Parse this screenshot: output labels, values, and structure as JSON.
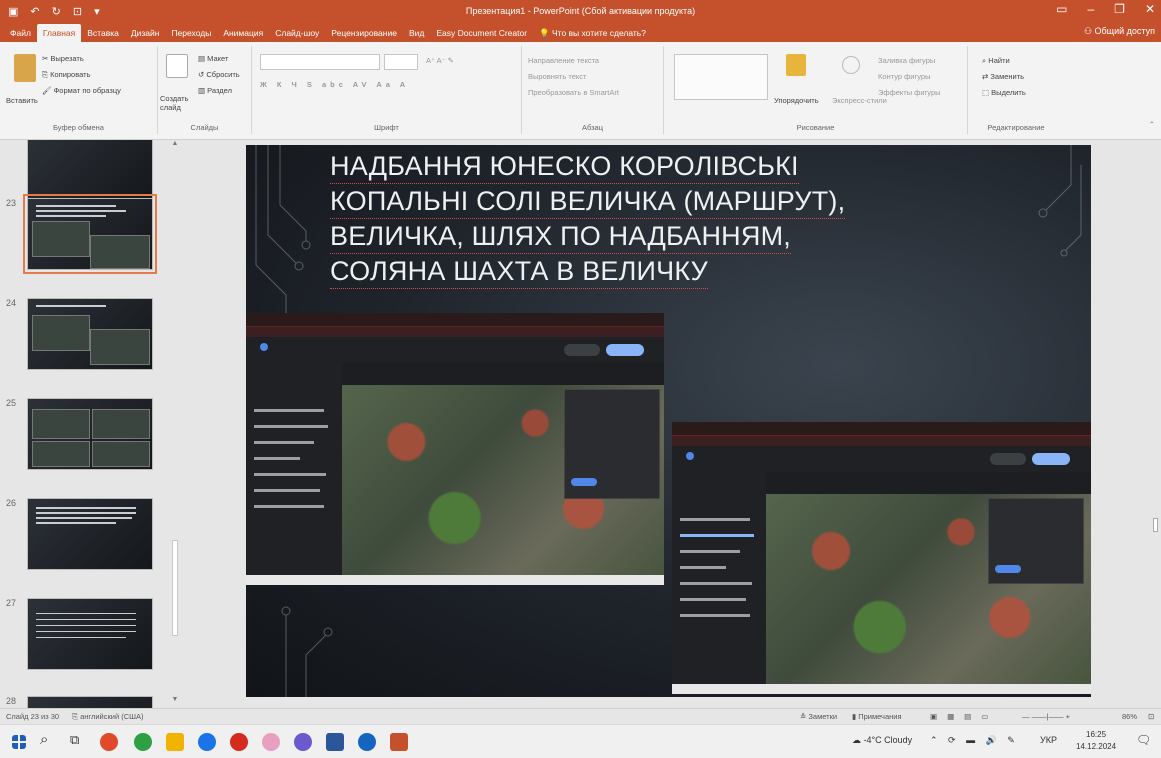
{
  "window": {
    "title": "Презентация1 - PowerPoint (Сбой активации продукта)"
  },
  "tabs": [
    "Файл",
    "Главная",
    "Вставка",
    "Дизайн",
    "Переходы",
    "Анимация",
    "Слайд-шоу",
    "Рецензирование",
    "Вид",
    "Easy Document Creator",
    "Что вы хотите сделать?"
  ],
  "active_tab_index": 1,
  "share_label": "Общий доступ",
  "ribbon": {
    "clipboard": {
      "paste": "Вставить",
      "cut": "Вырезать",
      "copy": "Копировать",
      "format_painter": "Формат по образцу",
      "label": "Буфер обмена"
    },
    "slides": {
      "new_slide": "Создать слайд",
      "layout": "Макет",
      "reset": "Сбросить",
      "section": "Раздел",
      "label": "Слайды"
    },
    "font": {
      "label": "Шрифт"
    },
    "paragraph": {
      "text_direction": "Направление текста",
      "align_text": "Выровнять текст",
      "smartart": "Преобразовать в SmartArt",
      "label": "Абзац"
    },
    "drawing": {
      "arrange": "Упорядочить",
      "quick_styles": "Экспресс-стили",
      "shape_fill": "Заливка фигуры",
      "shape_outline": "Контур фигуры",
      "shape_effects": "Эффекты фигуры",
      "label": "Рисование"
    },
    "editing": {
      "find": "Найти",
      "replace": "Заменить",
      "select": "Выделить",
      "label": "Редактирование"
    }
  },
  "thumbnails": [
    {
      "num": "",
      "selected": false
    },
    {
      "num": "23",
      "selected": true
    },
    {
      "num": "24",
      "selected": false
    },
    {
      "num": "25",
      "selected": false
    },
    {
      "num": "26",
      "selected": false
    },
    {
      "num": "27",
      "selected": false
    },
    {
      "num": "28",
      "selected": false
    }
  ],
  "slide": {
    "title_lines": [
      "НАДБАННЯ ЮНЕСКО КОРОЛІВСЬКІ",
      "КОПАЛЬНІ СОЛІ ВЕЛИЧКА (МАРШРУТ),",
      "ВЕЛИЧКА, ШЛЯХ ПО НАДБАННЯМ,",
      "СОЛЯНА ШАХТА В ВЕЛИЧКУ"
    ]
  },
  "statusbar": {
    "slide_info": "Слайд 23 из 30",
    "language": "английский (США)",
    "notes": "Заметки",
    "comments": "Примечания",
    "zoom": "86%"
  },
  "taskbar": {
    "weather": "-4°C Cloudy",
    "lang": "УКР",
    "time": "16:25",
    "date": "14.12.2024"
  },
  "colors": {
    "accent": "#c5512c",
    "slide_bg": "#1f242b",
    "title_text": "#eef0f2"
  }
}
